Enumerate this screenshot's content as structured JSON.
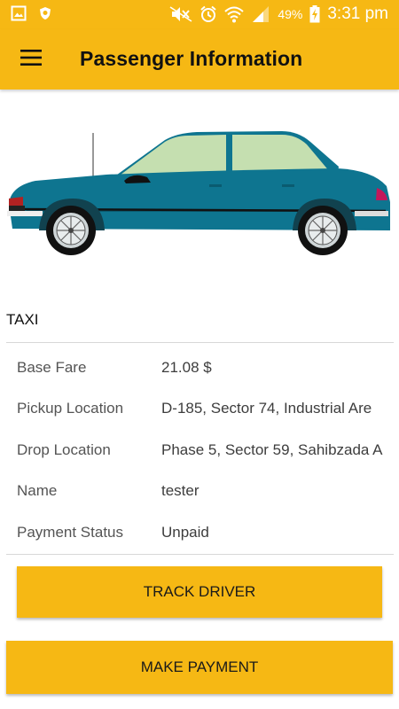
{
  "status_bar": {
    "battery_percent": "49%",
    "time": "3:31 pm",
    "icons": [
      "gallery-icon",
      "shield-icon",
      "mute-icon",
      "alarm-icon",
      "wifi-icon",
      "signal-icon",
      "battery-charging-icon"
    ],
    "background_color": "#f6b814"
  },
  "header": {
    "title": "Passenger Information",
    "menu_icon": "hamburger-menu-icon"
  },
  "vehicle": {
    "image": "car-illustration",
    "body_color": "#0e7590",
    "window_color": "#c5dfb0",
    "type": "TAXI"
  },
  "details": [
    {
      "label": "Base Fare",
      "value": "21.08 $"
    },
    {
      "label": "Pickup Location",
      "value": "D-185, Sector 74, Industrial Are"
    },
    {
      "label": "Drop Location",
      "value": "Phase 5, Sector 59, Sahibzada A"
    },
    {
      "label": "Name",
      "value": "tester"
    },
    {
      "label": "Payment Status",
      "value": "Unpaid"
    }
  ],
  "actions": {
    "track_driver_label": "TRACK DRIVER",
    "make_payment_label": "MAKE PAYMENT"
  },
  "theme": {
    "accent": "#f6b814"
  }
}
